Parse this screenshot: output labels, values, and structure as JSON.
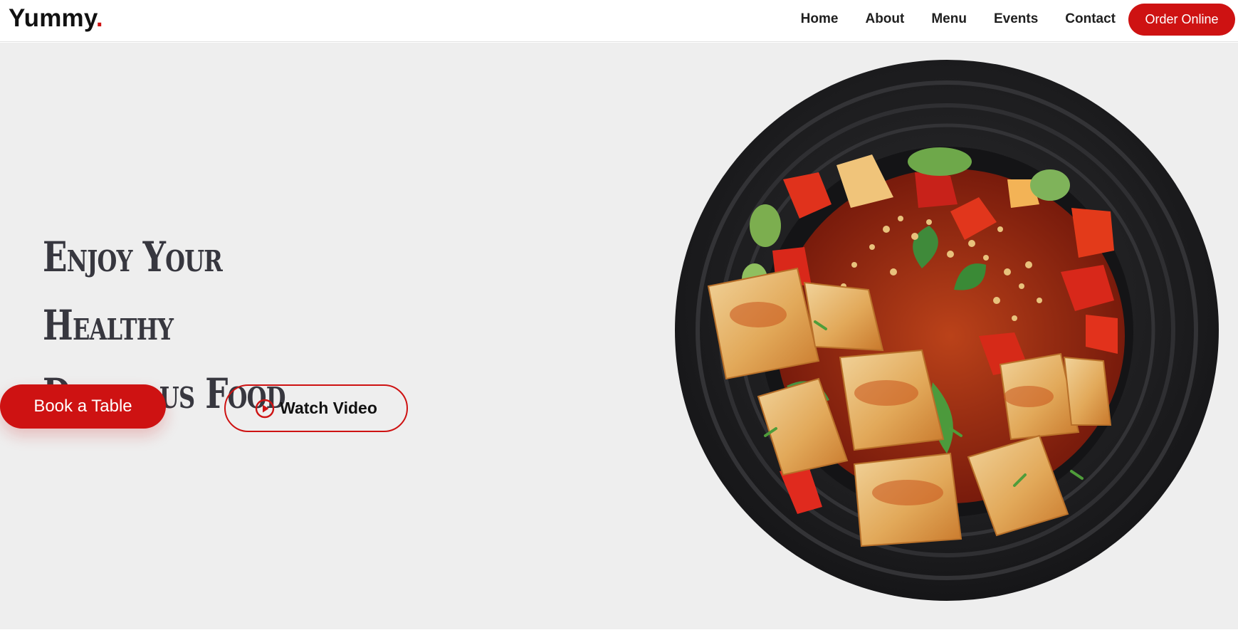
{
  "header": {
    "logo_text": "Yummy",
    "logo_dot": ".",
    "nav": [
      "Home",
      "About",
      "Menu",
      "Events",
      "Contact"
    ],
    "cta_label": "Order Online"
  },
  "hero": {
    "title_line1": "Enjoy Your Healthy",
    "title_line2": "Delicious Food",
    "book_label": "Book a Table",
    "video_label": "Watch Video",
    "video_icon": "play-circle-icon",
    "image_subject": "plate-of-food"
  },
  "colors": {
    "accent": "#ce1212",
    "hero_bg": "#eeeeee",
    "title": "#37373f",
    "text": "#1f1f1f"
  }
}
